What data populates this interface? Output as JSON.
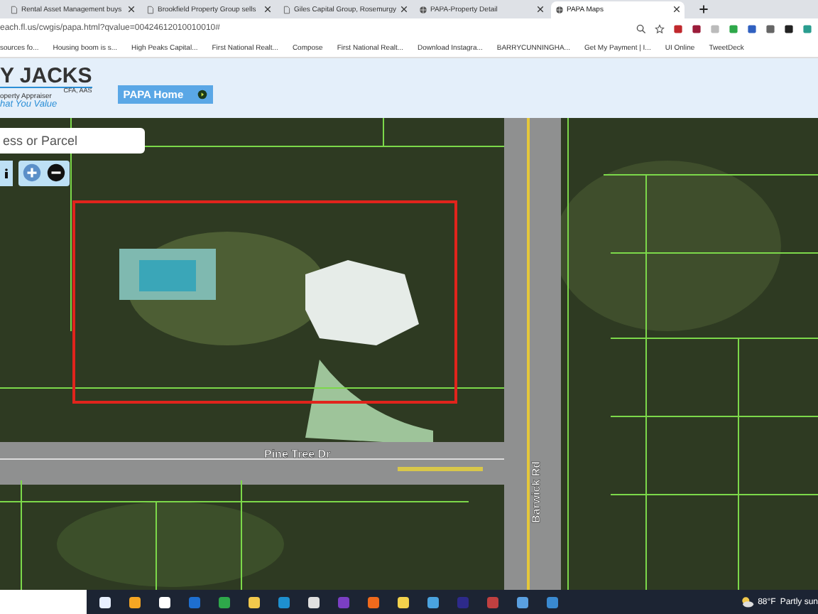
{
  "tabs": [
    {
      "label": "Rental Asset Management buys",
      "selected": false
    },
    {
      "label": "Brookfield Property Group sells",
      "selected": false
    },
    {
      "label": "Giles Capital Group, Rosemurgy",
      "selected": false
    },
    {
      "label": "PAPA-Property Detail",
      "selected": false
    },
    {
      "label": "PAPA Maps",
      "selected": true
    }
  ],
  "address": "each.fl.us/cwgis/papa.html?qvalue=00424612010010010#",
  "bookmarks": [
    "sources fo...",
    "Housing boom is s...",
    "High Peaks Capital...",
    "First National Realt...",
    "Compose",
    "First National Realt...",
    "Download Instagra...",
    "BARRYCUNNINGHA...",
    "Get My Payment | I...",
    "UI Online",
    "TweetDeck"
  ],
  "header": {
    "logo": "Y JACKS",
    "credentials": "CFA, AAS",
    "subtitle": "operty Appraiser",
    "tagline": "hat You Value",
    "home_button": "PAPA Home"
  },
  "search": {
    "placeholder": "ess or Parcel"
  },
  "map": {
    "streets": [
      {
        "name": "Pine Tree Dr",
        "kind": "horizontal"
      },
      {
        "name": "Barwick Rd",
        "kind": "vertical"
      }
    ]
  },
  "taskbar": {
    "weather": "88°F",
    "forecast": "Partly sun"
  }
}
